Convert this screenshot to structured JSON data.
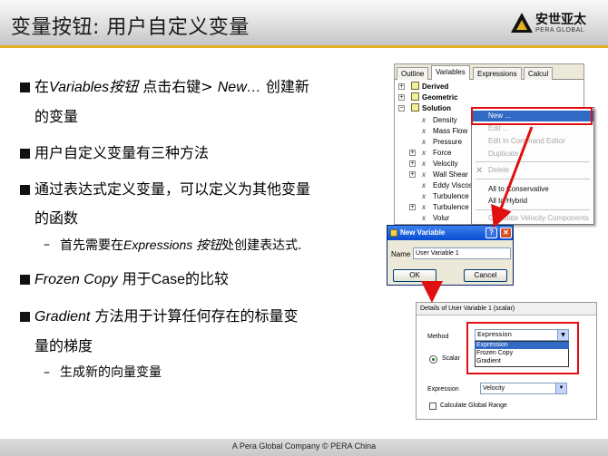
{
  "header": {
    "title": "变量按钮: 用户自定义变量",
    "logo_cn": "安世亚太",
    "logo_en": "PERA GLOBAL"
  },
  "bullets": {
    "b1_pre": "在",
    "b1_italic": "Variables按钮",
    "b1_post": " 点击右键> ",
    "b1_italic2": "New…",
    "b1_post2": " 创建新",
    "b1_line2": "的变量",
    "b2": "用户自定义变量有三种方法",
    "b3_line1": "通过表达式定义变量，可以定义为其他变量",
    "b3_line2": "的函数",
    "b3_sub_pre": "首先需要在",
    "b3_sub_italic": "Expressions 按钮",
    "b3_sub_post": "处创建表达式.",
    "b4_italic": "Frozen Copy",
    "b4_mid": " 用于",
    "b4_case": "Case",
    "b4_post": "的比较",
    "b5_italic": "Gradient",
    "b5_line1": " 方法用于计算任何存在的标量变",
    "b5_line2": "量的梯度",
    "b5_sub": "生成新的向量变量",
    "dash": "–"
  },
  "footer": {
    "text": "A Pera Global Company © PERA China"
  },
  "tree_panel": {
    "tabs": [
      "Outline",
      "Variables",
      "Expressions",
      "Calcul"
    ],
    "active_tab": "Variables",
    "groups": [
      "Derived",
      "Geometric",
      "Solution"
    ],
    "items": [
      "Density",
      "Mass Flow",
      "Pressure",
      "Force",
      "Velocity",
      "Wall Shear",
      "Eddy Viscosi",
      "Turbulence E",
      "Turbulence K",
      "Volur"
    ]
  },
  "context_menu": {
    "items": [
      "New ...",
      "Edit ...",
      "Edit In Command Editor",
      "Duplicate ...",
      "Delete",
      "All to Conservative",
      "All to Hybrid",
      "Calculate Velocity Components"
    ]
  },
  "new_dialog": {
    "title": "New Variable",
    "help": "?",
    "close": "✕",
    "name_label": "Name",
    "name_value": "User Variable 1",
    "ok_label": "OK",
    "cancel_label": "Cancel"
  },
  "details_panel": {
    "title": "Details of User Variable 1 (scalar)",
    "method_label": "Method",
    "method_value": "Expression",
    "method_options": [
      "Expression",
      "Frozen Copy",
      "Gradient"
    ],
    "scalar_label": "Scalar",
    "expression_label": "Expression",
    "expression_value": "Velocity",
    "global_range_label": "Calculate Global Range"
  },
  "colors": {
    "accent_line": "#e0b020",
    "selection": "#316ac5",
    "highlight_red": "#e01010"
  }
}
